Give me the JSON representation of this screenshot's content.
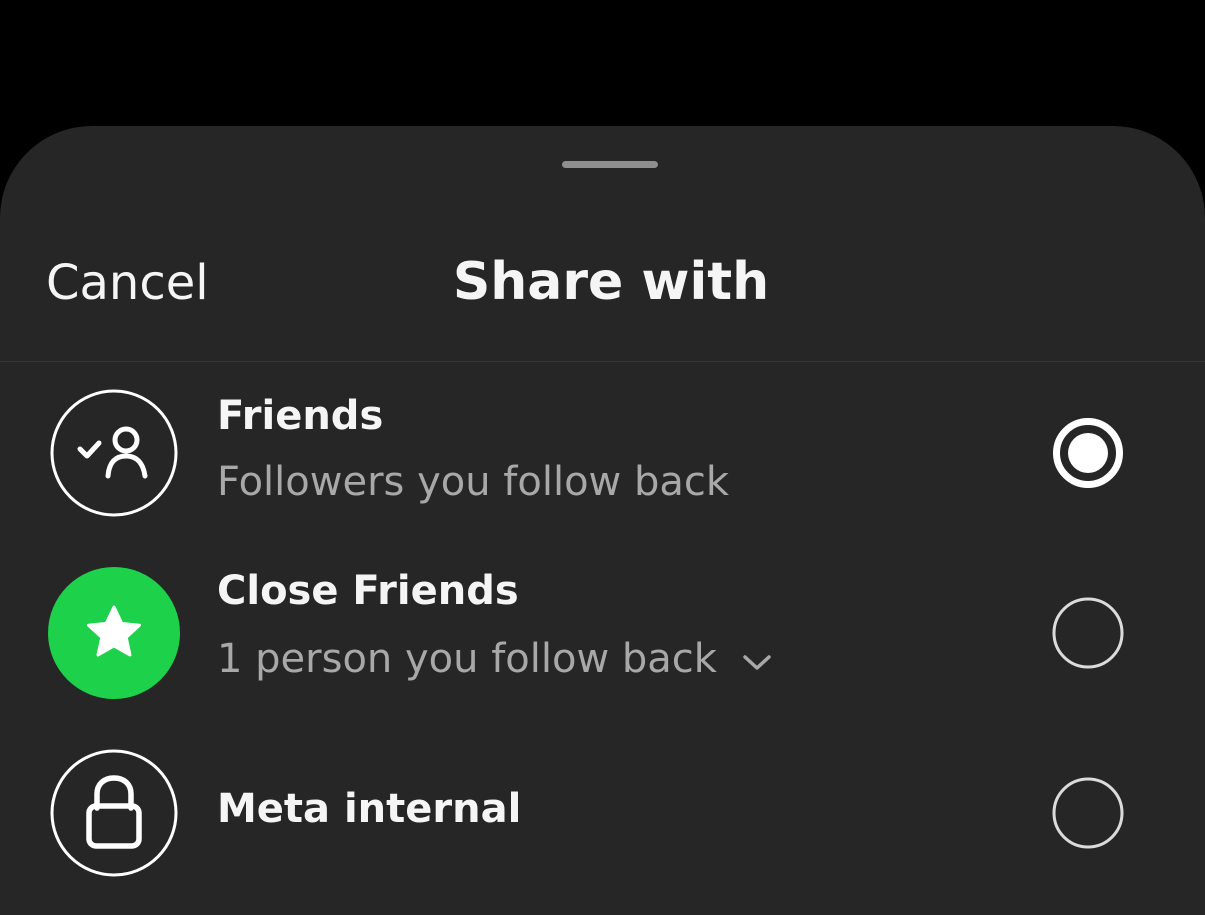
{
  "sheet": {
    "cancel_label": "Cancel",
    "title": "Share with"
  },
  "options": [
    {
      "title": "Friends",
      "subtitle": "Followers you follow back",
      "icon": "person-check-icon",
      "selected": true
    },
    {
      "title": "Close Friends",
      "subtitle": "1 person you follow back",
      "icon": "star-icon",
      "selected": false
    },
    {
      "title": "Meta internal",
      "icon": "lock-icon",
      "selected": false
    }
  ],
  "colors": {
    "background": "#000000",
    "sheet": "#262626",
    "text_primary": "#f5f5f5",
    "text_secondary": "#a8a8a8",
    "close_friends_green": "#1ed14b",
    "radio_selected": "#ffffff"
  }
}
